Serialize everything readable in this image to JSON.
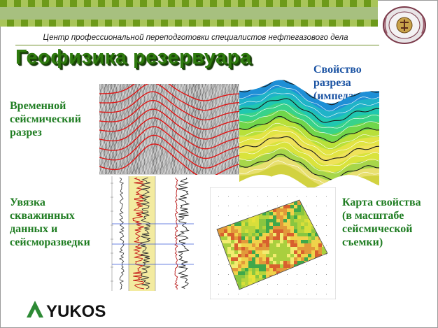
{
  "header": {
    "center_title": "Центр профессиональной переподготовки специалистов нефтегазового дела"
  },
  "slide": {
    "title": "Геофизика резервуара"
  },
  "labels": {
    "seismic_section": "Временной сейсмический разрез",
    "impedance": "Свойство разреза (импеданс)",
    "well_tie": "Увязка скважинных данных и сейсморазведки",
    "property_map": "Карта свойства (в масштабе сейсмической съемки)"
  },
  "logo": {
    "text": "YUKOS"
  },
  "colors": {
    "title_green": "#2e7a0e",
    "label_green": "#1f7d22",
    "label_blue": "#1b53a3",
    "stripe_green": "#6d9a1a"
  }
}
